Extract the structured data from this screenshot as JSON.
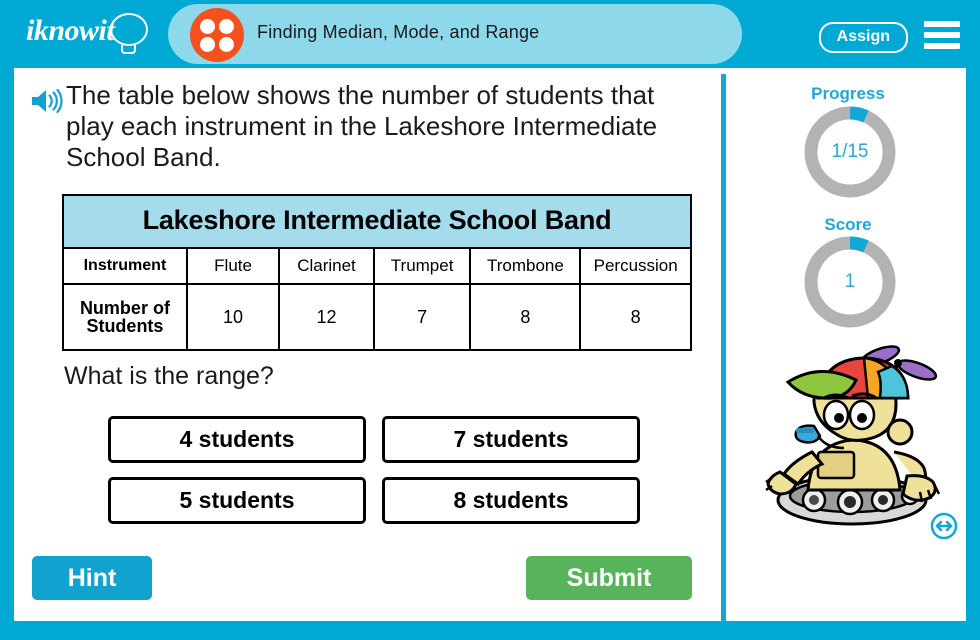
{
  "header": {
    "logo_text": "iknowit",
    "logo_icon": "lightbulb-icon",
    "topic_icon": "four-dots-icon",
    "topic_title": "Finding Median, Mode, and Range",
    "assign_label": "Assign",
    "menu_icon": "hamburger-menu-icon"
  },
  "question": {
    "speaker_icon": "speaker-audio-icon",
    "text": "The table below shows the number of students that play each instrument in the Lakeshore Intermediate School Band.",
    "prompt": "What is the range?"
  },
  "table": {
    "title": "Lakeshore Intermediate School Band",
    "row_labels": [
      "Instrument",
      "Number of Students"
    ],
    "instruments": [
      "Flute",
      "Clarinet",
      "Trumpet",
      "Trombone",
      "Percussion"
    ],
    "counts": [
      "10",
      "12",
      "7",
      "8",
      "8"
    ]
  },
  "answers": [
    {
      "label": "4 students"
    },
    {
      "label": "7 students"
    },
    {
      "label": "5 students"
    },
    {
      "label": "8 students"
    }
  ],
  "footer": {
    "hint_label": "Hint",
    "submit_label": "Submit"
  },
  "panel": {
    "progress_label": "Progress",
    "progress_value": "1/15",
    "progress_percent": 6.7,
    "score_label": "Score",
    "score_value": "1",
    "score_percent": 6.7,
    "mascot_icon": "robot-mascot-icon",
    "resize_icon": "resize-horizontal-icon"
  },
  "colors": {
    "frame_blue": "#00a9d4",
    "header_pill": "#8ed8ec",
    "accent_teal": "#1fa8d6",
    "table_header": "#a4dceb",
    "submit_green": "#58b45b",
    "topic_orange": "#f4511e",
    "ring_track": "#b3b3b3"
  }
}
